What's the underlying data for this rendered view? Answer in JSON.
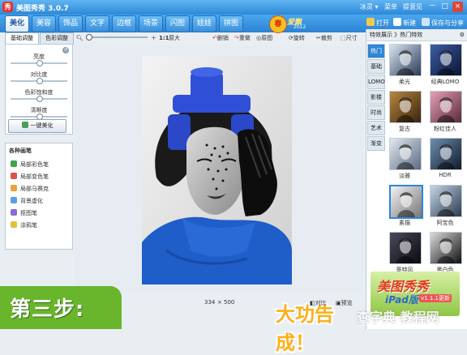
{
  "window": {
    "title": "美图秀秀 3.0.7",
    "minimize": "－",
    "maximize": "□",
    "close": "×"
  },
  "topright": {
    "user": "冰灵 ▾",
    "menu": "菜单",
    "feedback": "提意见"
  },
  "tabs": [
    {
      "label": "美化",
      "active": true
    },
    {
      "label": "美容"
    },
    {
      "label": "饰品"
    },
    {
      "label": "文字"
    },
    {
      "label": "边框"
    },
    {
      "label": "场景"
    },
    {
      "label": "闪图"
    },
    {
      "label": "娃娃"
    },
    {
      "label": "拼图"
    }
  ],
  "badge": {
    "char": "春",
    "word": "爱飘",
    "year": "2012"
  },
  "topbuttons": {
    "open": "打开",
    "new": "新建",
    "save": "保存与分享"
  },
  "left": {
    "tab_basic": "基础调整",
    "tab_color": "色彩调整",
    "sliders": [
      {
        "label": "亮度",
        "value": 0.5
      },
      {
        "label": "对比度",
        "value": 0.5
      },
      {
        "label": "色彩饱和度",
        "value": 0.5
      },
      {
        "label": "清晰度",
        "value": 0.5
      }
    ],
    "beautify": "一键美化",
    "brushes_title": "各种画笔",
    "brushes": [
      "局部彩色笔",
      "局部变色笔",
      "局部马赛克",
      "背景虚化",
      "抠图笔",
      "涂鸦笔"
    ]
  },
  "toolbar": {
    "ratio": "1:1",
    "original": "原大",
    "rotate_l": "删销",
    "redo": "重做",
    "orig_img": "原图",
    "rotate": "旋转",
    "crop": "裁剪",
    "size": "尺寸"
  },
  "status": {
    "width": "334",
    "x": "×",
    "height": "500",
    "compare": "对比",
    "preview": "预览"
  },
  "caption": "大功告成！",
  "right": {
    "header": "特效展示 》热门特效",
    "cats": [
      {
        "label": "热门",
        "active": true
      },
      {
        "label": "基础"
      },
      {
        "label": "LOMO"
      },
      {
        "label": "影楼"
      },
      {
        "label": "时尚"
      },
      {
        "label": "艺术"
      },
      {
        "label": "渐变"
      }
    ],
    "effects": [
      {
        "label": "柔光"
      },
      {
        "label": "经典LOMO"
      },
      {
        "label": "复古"
      },
      {
        "label": "粉红佳人"
      },
      {
        "label": "淡雅"
      },
      {
        "label": "HDR"
      },
      {
        "label": "素描"
      },
      {
        "label": "阿宝色"
      },
      {
        "label": "哥特风"
      },
      {
        "label": "黑白色"
      }
    ]
  },
  "ipad_ad": {
    "line1": "美图秀秀",
    "line2": "iPad版",
    "tag": "v1.1.1更新"
  },
  "step_label": "第三步:",
  "watermark": {
    "site": "查字典 教程网",
    "url": "jiaocheng.chazidian.com"
  },
  "colors": {
    "accent": "#2e88d8",
    "caption": "#ffae1a",
    "step_bg": "#69b52b",
    "hat_blue": "#2f50d6"
  }
}
